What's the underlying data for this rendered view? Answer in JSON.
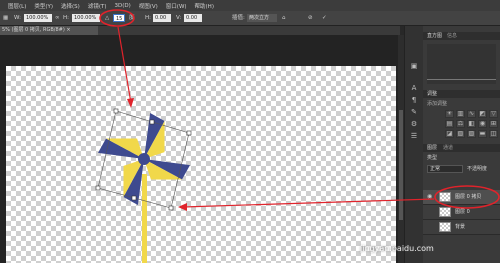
{
  "menu": [
    "图层(L)",
    "类型(Y)",
    "选择(S)",
    "滤镜(T)",
    "3D(D)",
    "视图(V)",
    "窗口(W)",
    "帮助(H)"
  ],
  "options": {
    "w_label": "W:",
    "w_value": "100.00%",
    "h_label": "H:",
    "h_value": "100.00%",
    "angle_label": "△",
    "angle_value": "15",
    "deg": "度",
    "hskew_label": "H:",
    "hskew_value": "0.00",
    "vskew_label": "V:",
    "vskew_value": "0.00",
    "interp_label": "插值:",
    "interp_value": "两次立方"
  },
  "doc_tab": "5% (图层 0 拷贝, RGB/8#) ×",
  "panels": {
    "top_tabs": [
      "直方图",
      "信息"
    ],
    "adjust_title": "调整",
    "adjust_subtitle": "添加调整",
    "layers_tabs": [
      "图层",
      "通道"
    ],
    "kind_label": "类型",
    "blend_mode": "正常",
    "opacity_label": "不透明度"
  },
  "layers": [
    {
      "name": "图层 0 拷贝",
      "selected": true
    },
    {
      "name": "图层 0",
      "selected": false
    },
    {
      "name": "背景",
      "selected": false
    }
  ],
  "watermark": "jingyan.baidu.com",
  "colors": {
    "accent_red": "#e0232b",
    "pinwheel_yellow": "#f1d84a",
    "pinwheel_navy": "#3e4a8f"
  }
}
